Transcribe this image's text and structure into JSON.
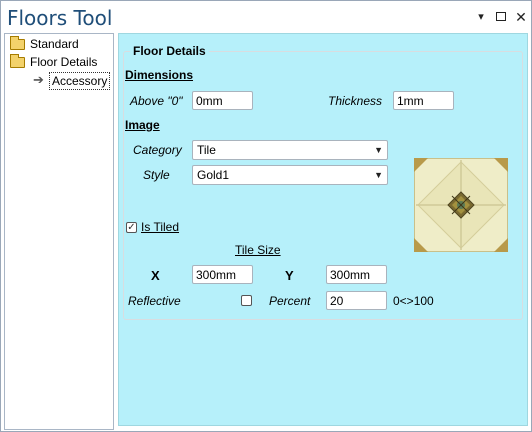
{
  "window": {
    "title": "Floors Tool"
  },
  "titlebar_buttons": {
    "dropdown": "▾",
    "close": "✕"
  },
  "tree": {
    "items": [
      {
        "label": "Standard",
        "icon": "folder-icon"
      },
      {
        "label": "Floor Details",
        "icon": "folder-icon"
      },
      {
        "label": "Accessory",
        "icon": "arrow-right-icon",
        "selected": true
      }
    ]
  },
  "panel": {
    "group_title": "Floor Details",
    "dimensions": {
      "heading": "Dimensions",
      "above_label": "Above \"0\"",
      "above_value": "0mm",
      "thickness_label": "Thickness",
      "thickness_value": "1mm"
    },
    "image": {
      "heading": "Image",
      "category_label": "Category",
      "category_value": "Tile",
      "style_label": "Style",
      "style_value": "Gold1",
      "is_tiled_label": "Is Tiled",
      "is_tiled_checked": true,
      "checkmark": "✓"
    },
    "tile_size": {
      "heading": "Tile Size",
      "x_label": "X",
      "x_value": "300mm",
      "y_label": "Y",
      "y_value": "300mm"
    },
    "reflective": {
      "label": "Reflective",
      "checked": false,
      "percent_label": "Percent",
      "percent_value": "20",
      "range_text": "0<>100"
    }
  },
  "colors": {
    "title": "#1f4e79",
    "panel_background": "#b6f0fa",
    "tile_base": "#efedc8"
  }
}
